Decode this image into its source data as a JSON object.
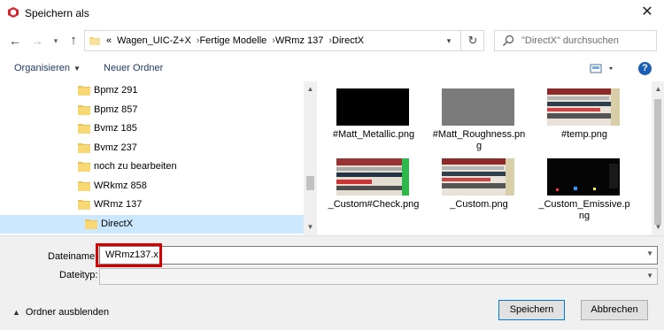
{
  "window": {
    "title": "Speichern als"
  },
  "breadcrumb": {
    "overflow": "«",
    "parts": [
      "Wagen_UIC-Z+X",
      "Fertige Modelle",
      "WRmz 137",
      "DirectX"
    ]
  },
  "search": {
    "placeholder": "\"DirectX\" durchsuchen"
  },
  "toolbar": {
    "organize": "Organisieren",
    "new_folder": "Neuer Ordner",
    "help": "?"
  },
  "tree": {
    "items": [
      {
        "label": "Bpmz 291"
      },
      {
        "label": "Bpmz 857"
      },
      {
        "label": "Bvmz 185"
      },
      {
        "label": "Bvmz 237"
      },
      {
        "label": "noch zu bearbeiten"
      },
      {
        "label": "WRkmz 858"
      },
      {
        "label": "WRmz 137"
      },
      {
        "label": "DirectX",
        "selected": true
      }
    ]
  },
  "files": [
    {
      "name": "#Matt_Metallic.png",
      "thumb": "black"
    },
    {
      "name": "#Matt_Roughness.png",
      "thumb": "gray"
    },
    {
      "name": "#temp.png",
      "thumb": "texture"
    },
    {
      "name": "_Custom#Check.png",
      "thumb": "texture-green"
    },
    {
      "name": "_Custom.png",
      "thumb": "texture"
    },
    {
      "name": "_Custom_Emissive.png",
      "thumb": "dark"
    }
  ],
  "form": {
    "filename_label": "Dateiname:",
    "filename_value": "WRmz137.x",
    "filetype_label": "Dateityp:",
    "filetype_value": ""
  },
  "footer": {
    "hide_folders": "Ordner ausblenden",
    "save": "Speichern",
    "cancel": "Abbrechen"
  },
  "colors": {
    "accent": "#0078d7",
    "highlight": "#d50000",
    "selected": "#cce8ff"
  }
}
